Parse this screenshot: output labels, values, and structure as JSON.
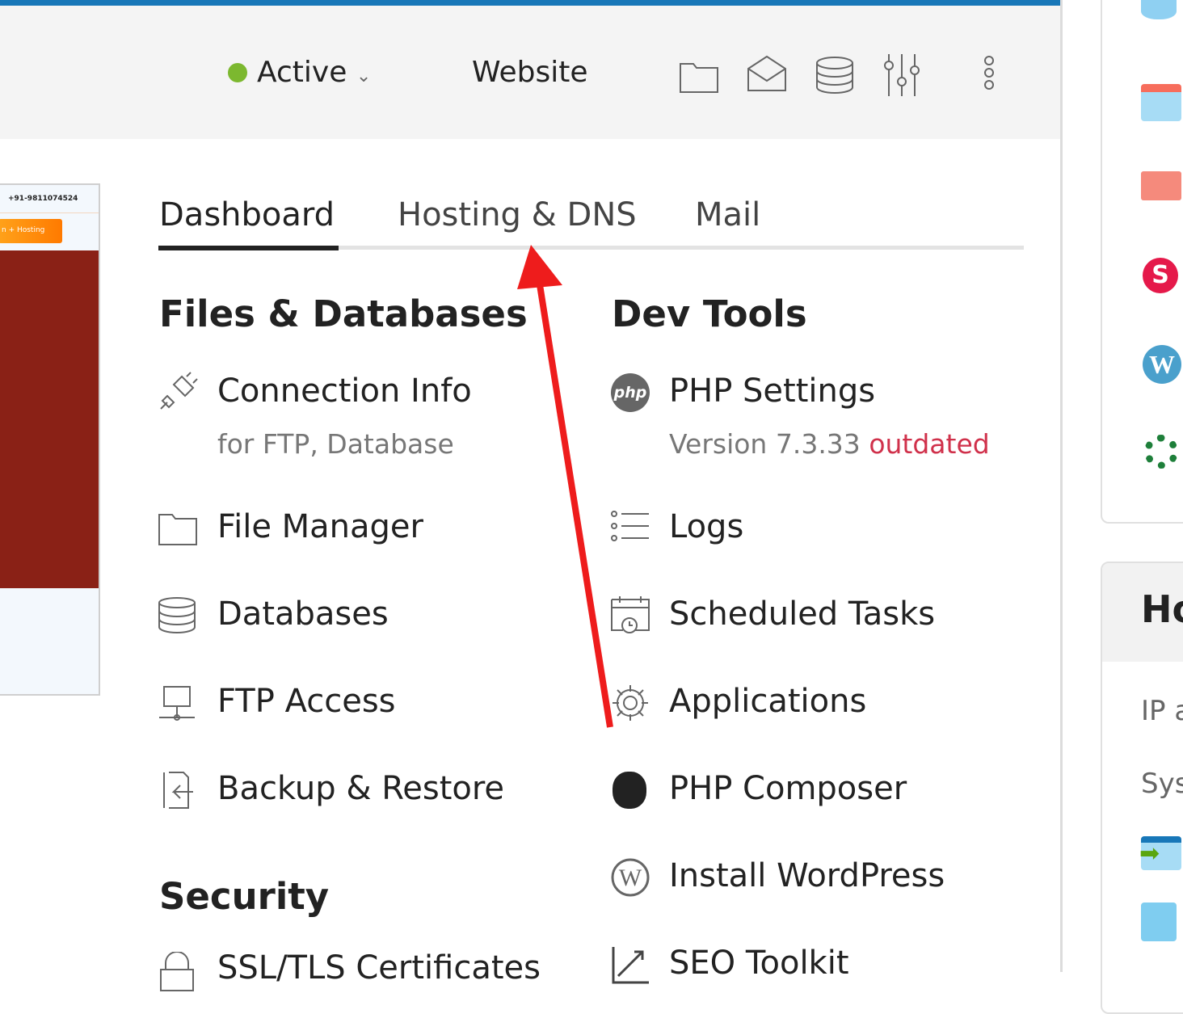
{
  "header": {
    "status": "Active",
    "website": "Website",
    "icons": [
      "folder-icon",
      "mail-icon",
      "database-icon",
      "sliders-icon",
      "more-vertical-icon"
    ],
    "status_color": "#7cb82f"
  },
  "preview": {
    "phone": "+91-9811074524",
    "button": "n + Hosting"
  },
  "tabs": [
    {
      "label": "Dashboard",
      "active": true
    },
    {
      "label": "Hosting & DNS"
    },
    {
      "label": "Mail"
    }
  ],
  "files": {
    "title": "Files & Databases",
    "items": [
      {
        "label": "Connection Info",
        "sub": "for FTP, Database"
      },
      {
        "label": "File Manager"
      },
      {
        "label": "Databases"
      },
      {
        "label": "FTP Access"
      },
      {
        "label": "Backup & Restore"
      }
    ]
  },
  "security": {
    "title": "Security",
    "items": [
      {
        "label": "SSL/TLS Certificates"
      }
    ]
  },
  "dev": {
    "title": "Dev Tools",
    "items": [
      {
        "label": "PHP Settings",
        "sub": "Version 7.3.33",
        "badge": "outdated"
      },
      {
        "label": "Logs"
      },
      {
        "label": "Scheduled Tasks"
      },
      {
        "label": "Applications"
      },
      {
        "label": "PHP Composer"
      },
      {
        "label": "Install WordPress"
      },
      {
        "label": "SEO Toolkit"
      }
    ]
  },
  "right": {
    "title": "Ho",
    "lines": [
      "IP a",
      "Sys"
    ]
  },
  "colors": {
    "accent": "#1877b8",
    "outdated": "#d0314b",
    "annotation": "#ee1c1c"
  }
}
